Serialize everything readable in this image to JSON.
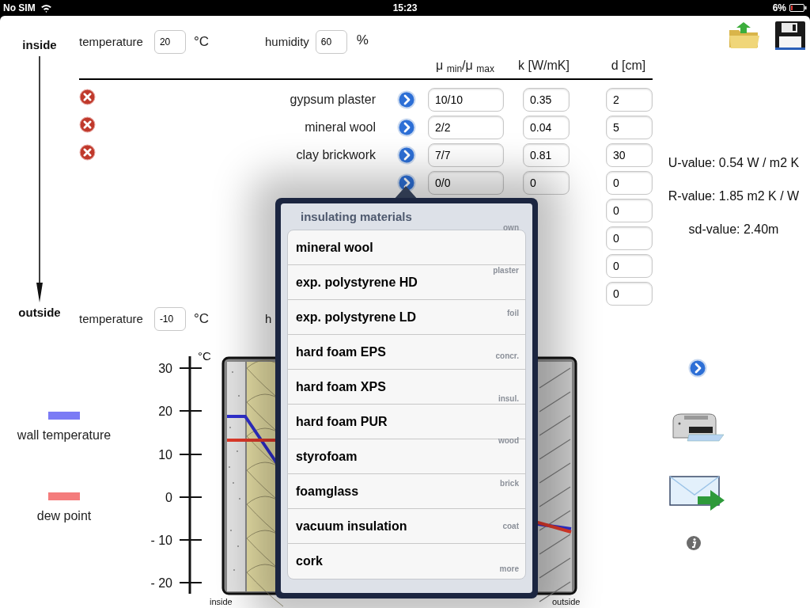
{
  "status_bar": {
    "carrier": "No SIM",
    "time": "15:23",
    "battery": "6%"
  },
  "sides": {
    "inside": "inside",
    "outside": "outside"
  },
  "inside_conditions": {
    "temperature_label": "temperature",
    "temperature": "20",
    "temperature_unit": "°C",
    "humidity_label": "humidity",
    "humidity": "60",
    "humidity_unit": "%"
  },
  "columns": [
    "μ $_{min}$/μ $_{max}$",
    "k [W/mK]",
    "d [cm]"
  ],
  "layers": [
    {
      "name": "gypsum plaster",
      "removable": true,
      "picker": true,
      "mu": "10/10",
      "k": "0.35",
      "d": "2"
    },
    {
      "name": "mineral wool",
      "removable": true,
      "picker": true,
      "mu": "2/2",
      "k": "0.04",
      "d": "5"
    },
    {
      "name": "clay brickwork",
      "removable": true,
      "picker": true,
      "mu": "7/7",
      "k": "0.81",
      "d": "30"
    },
    {
      "removable": false,
      "picker": true,
      "mu": "0/0",
      "k": "0",
      "d": "0"
    },
    {
      "removable": false,
      "picker": false,
      "d": "0"
    },
    {
      "removable": false,
      "picker": false,
      "d": "0"
    },
    {
      "removable": false,
      "picker": false,
      "d": "0"
    },
    {
      "removable": false,
      "picker": false,
      "d": "0"
    }
  ],
  "outside_conditions": {
    "temperature_label": "temperature",
    "temperature": "-10",
    "temperature_unit": "°C",
    "humidity_label": "h"
  },
  "results": [
    "U-value: 0.54 W / m2 K",
    "R-value: 1.85 m2 K / W",
    "sd-value: 2.40m"
  ],
  "legend": [
    {
      "label": "wall temperature",
      "color": "#7b7bf5"
    },
    {
      "label": "dew point",
      "color": "#f47c7c"
    }
  ],
  "chart": {
    "unit": "°C",
    "ticks": [
      "30",
      "20",
      "10",
      "0",
      "- 10",
      "- 20"
    ],
    "inside_label": "inside",
    "outside_label": "outside"
  },
  "popover": {
    "title": "insulating materials",
    "items": [
      "mineral wool",
      "exp. polystyrene HD",
      "exp. polystyrene LD",
      "hard foam EPS",
      "hard foam XPS",
      "hard foam PUR",
      "styrofoam",
      "foamglass",
      "vacuum insulation",
      "cork"
    ],
    "index": [
      "own",
      "plaster",
      "foil",
      "concr.",
      "insul.",
      "wood",
      "brick",
      "coat",
      "more"
    ]
  }
}
